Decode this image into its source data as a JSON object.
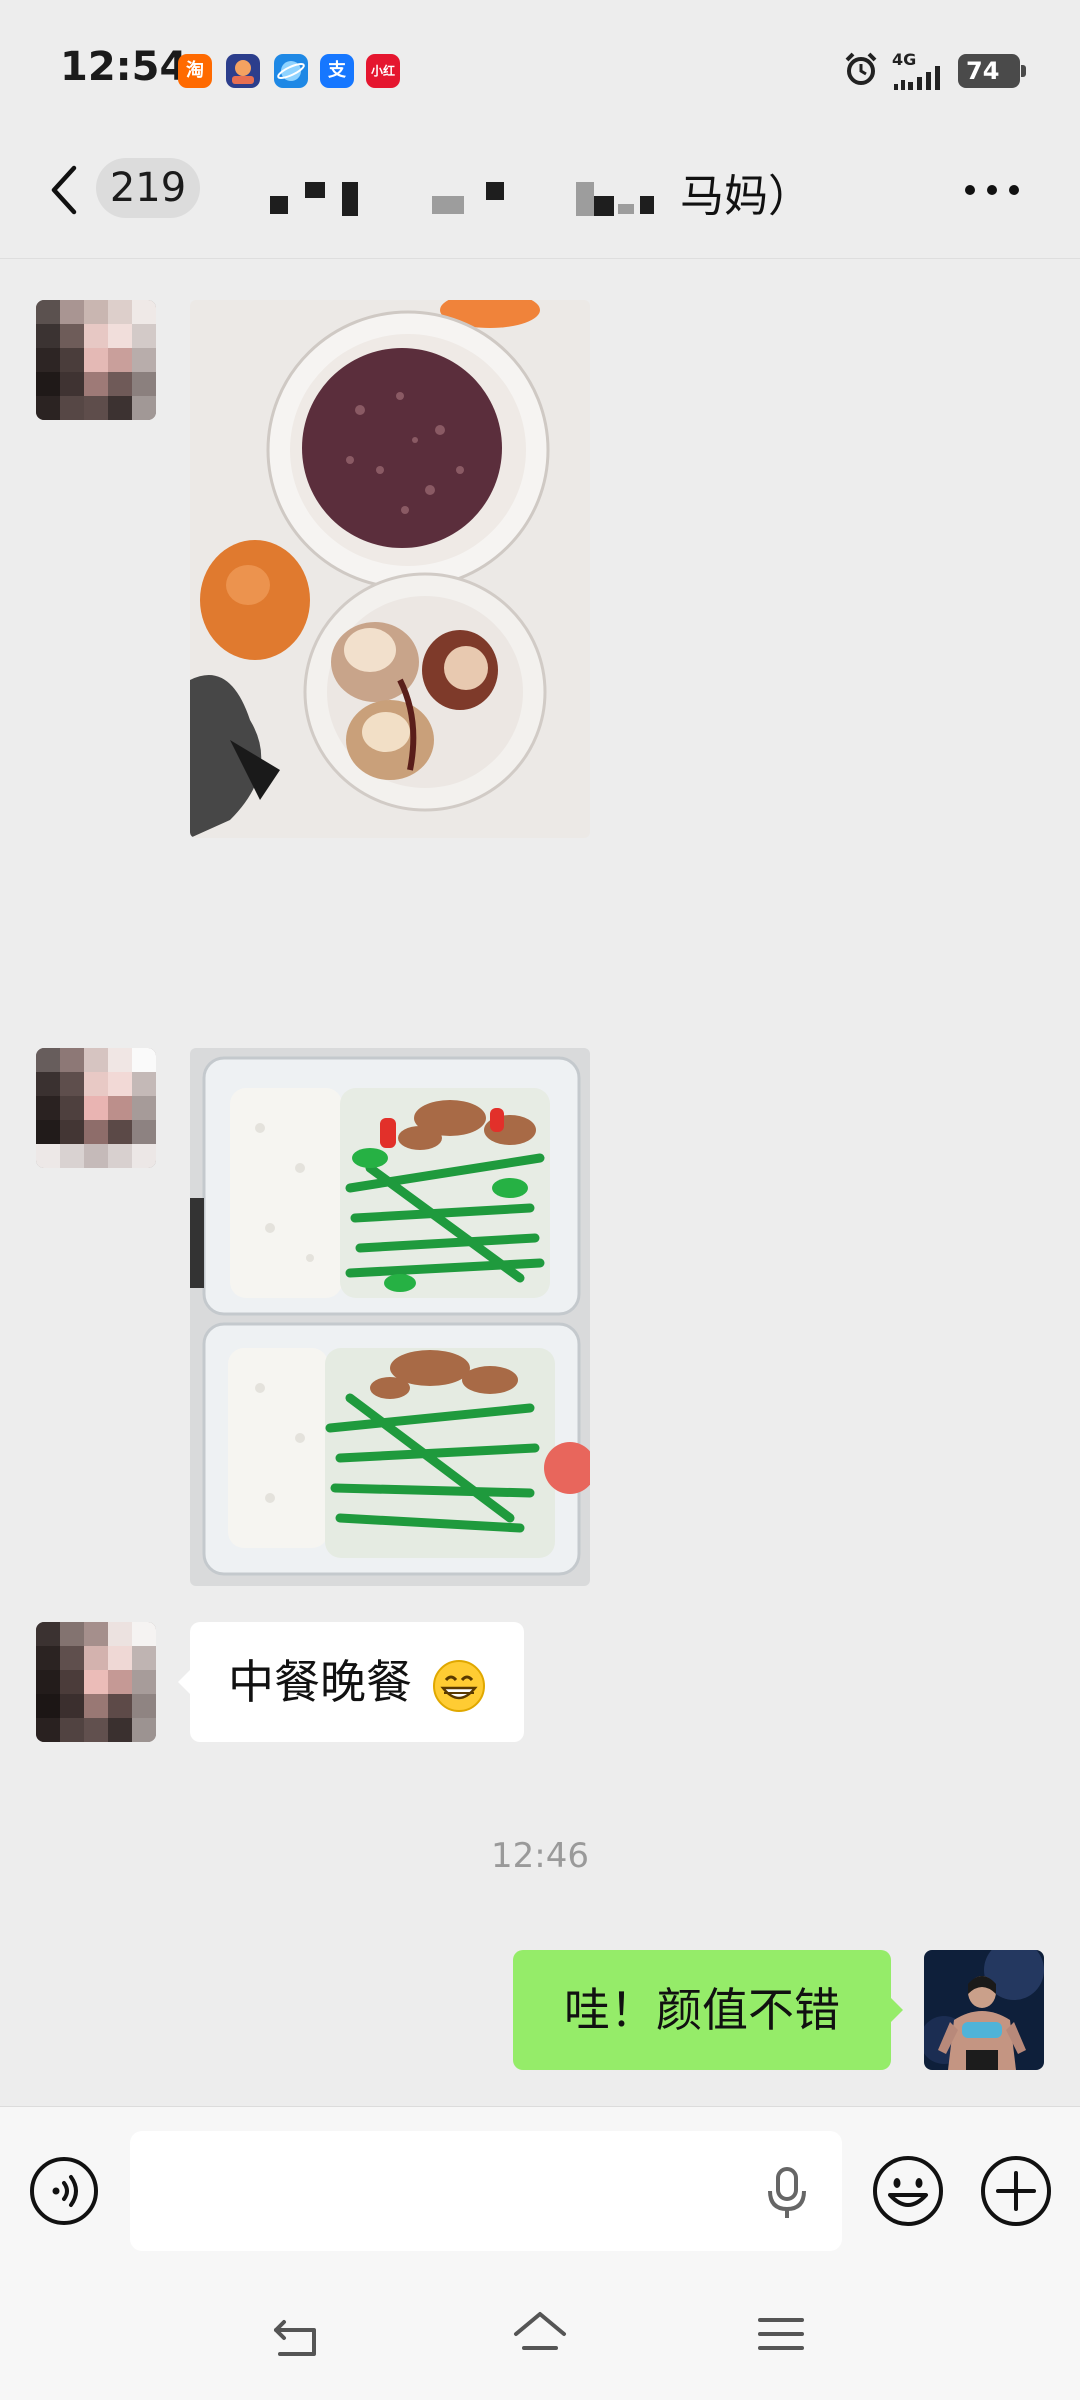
{
  "status_bar": {
    "time": "12:54",
    "notification_icons": [
      "淘",
      "game-app-icon",
      "browser-icon",
      "支",
      "小红书"
    ],
    "network": "4G",
    "battery": "74"
  },
  "header": {
    "unread_count": "219",
    "title_visible": "马妈）"
  },
  "messages": [
    {
      "type": "image",
      "from": "contact",
      "description_icon": "meal-photo"
    },
    {
      "type": "image",
      "from": "contact",
      "description_icon": "lunchbox-photo"
    },
    {
      "type": "text",
      "from": "contact",
      "text": "中餐晚餐"
    },
    {
      "type": "timestamp",
      "text": "12:46"
    },
    {
      "type": "text",
      "from": "me",
      "text": "哇！颜值不错"
    }
  ],
  "input_bar": {
    "placeholder": "",
    "voice_icon": "voice-icon",
    "emoji_icon": "emoji-icon",
    "plus_icon": "plus-icon"
  },
  "colors": {
    "background": "#ededed",
    "outgoing_bubble": "#95ec69",
    "incoming_bubble": "#ffffff"
  }
}
